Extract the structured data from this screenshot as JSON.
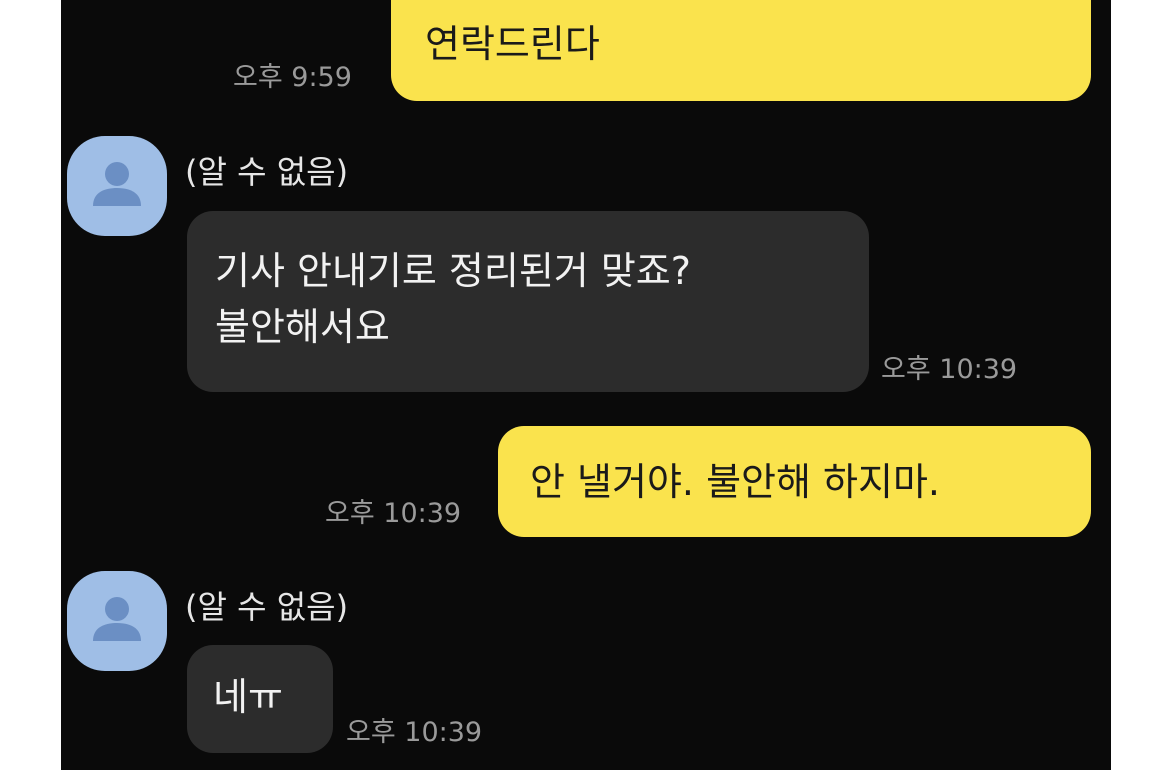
{
  "colors": {
    "background": "#0a0a0a",
    "my_bubble": "#fae34d",
    "their_bubble": "#2c2c2c",
    "avatar": "#9fbee6",
    "timestamp": "#9a9a9a"
  },
  "messages": [
    {
      "type": "sent",
      "text": "연락드린다",
      "time": "오후 9:59"
    },
    {
      "type": "received",
      "sender": "(알 수 없음)",
      "avatar_icon": "person-icon",
      "text": "기사 안내기로 정리된거 맞죠?\n불안해서요",
      "time": "오후 10:39"
    },
    {
      "type": "sent",
      "text": "안 낼거야. 불안해 하지마.",
      "time": "오후 10:39"
    },
    {
      "type": "received",
      "sender": "(알 수 없음)",
      "avatar_icon": "person-icon",
      "text": "네ㅠ",
      "time": "오후 10:39"
    }
  ]
}
